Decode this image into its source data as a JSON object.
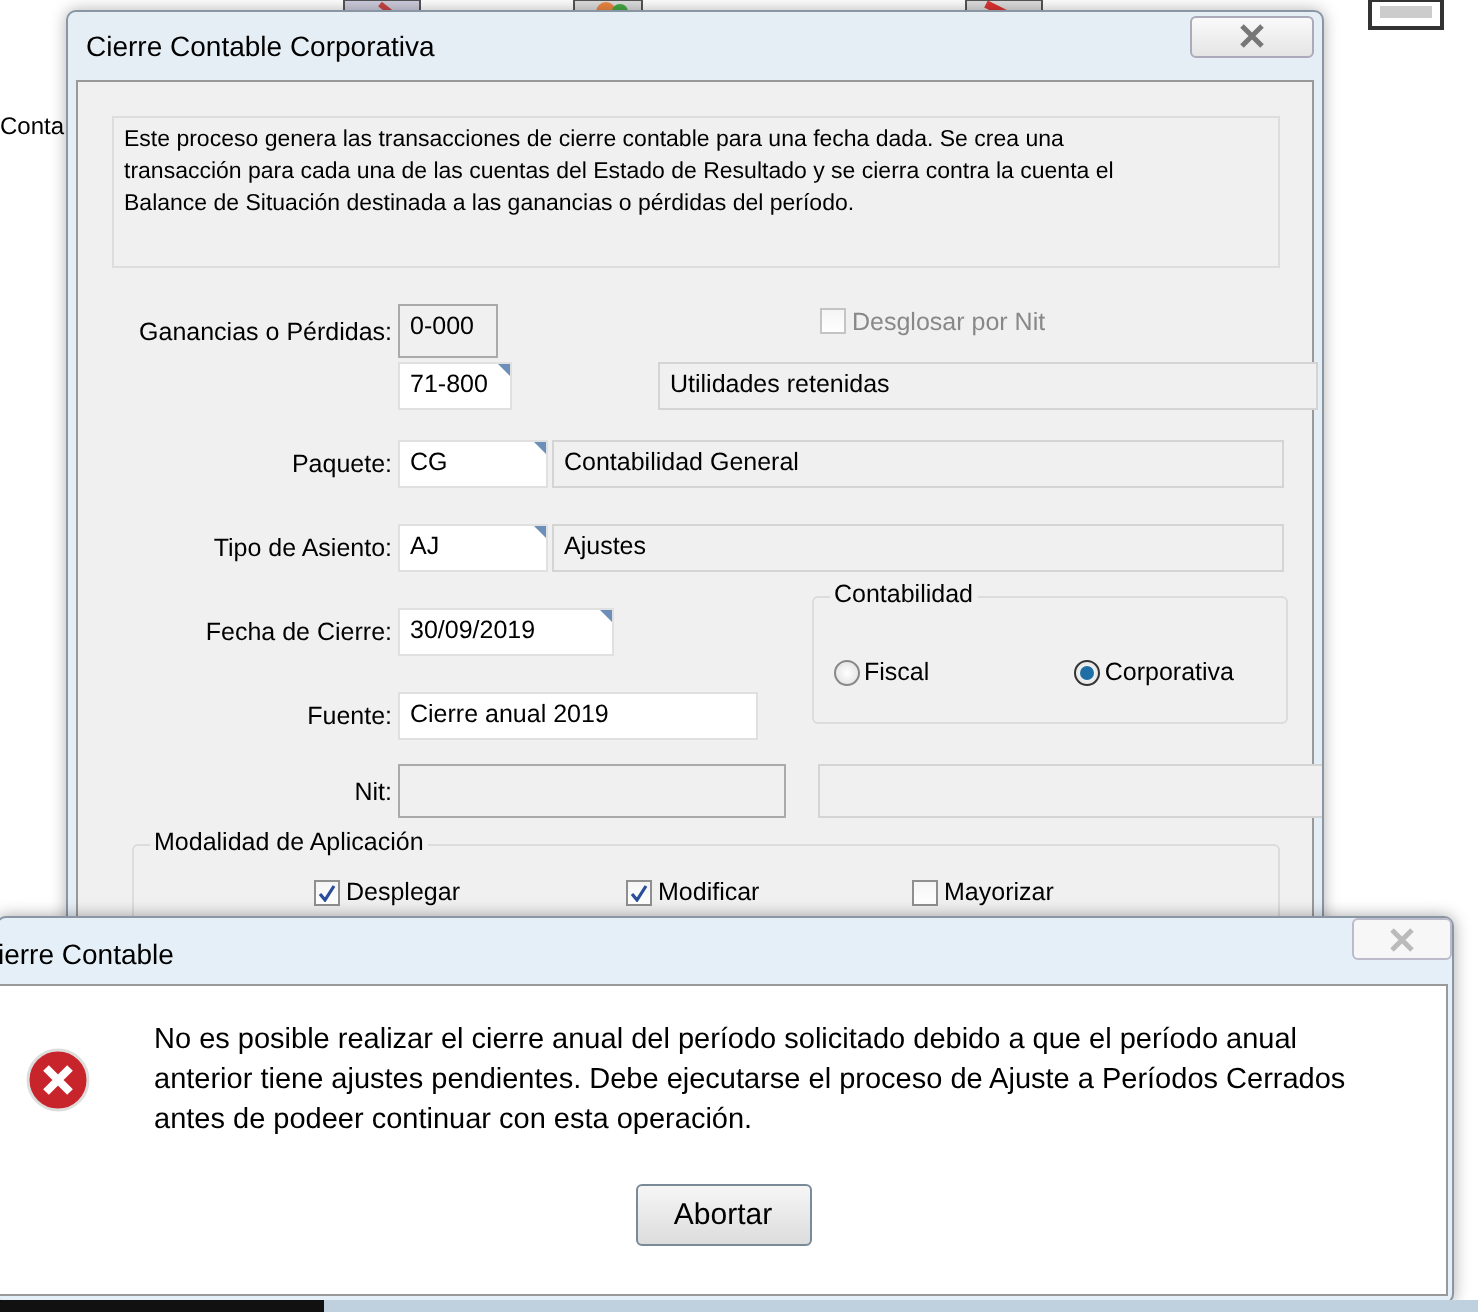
{
  "desktop": {
    "icon_labels": [
      "Conta"
    ]
  },
  "main_window": {
    "title": "Cierre Contable Corporativa",
    "description": "Este proceso genera las transacciones de cierre contable para una fecha dada. Se crea una transacción para cada una de las cuentas del Estado de Resultado y se cierra contra la cuenta el Balance de Situación destinada a las ganancias o pérdidas del período.",
    "ganancias": {
      "label": "Ganancias o Pérdidas:",
      "prefix": "0-000",
      "code": "71-800",
      "name": "Utilidades retenidas"
    },
    "desglosar": {
      "label": "Desglosar por Nit",
      "checked": false,
      "disabled": true
    },
    "paquete": {
      "label": "Paquete:",
      "code": "CG",
      "name": "Contabilidad General"
    },
    "tipo_asiento": {
      "label": "Tipo de Asiento:",
      "code": "AJ",
      "name": "Ajustes"
    },
    "fecha_cierre": {
      "label": "Fecha de Cierre:",
      "value": "30/09/2019"
    },
    "fuente": {
      "label": "Fuente:",
      "value": "Cierre anual 2019"
    },
    "nit": {
      "label": "Nit:"
    },
    "contabilidad": {
      "title": "Contabilidad",
      "options": [
        {
          "label": "Fiscal",
          "selected": false
        },
        {
          "label": "Corporativa",
          "selected": true
        }
      ]
    },
    "modalidad": {
      "title": "Modalidad de Aplicación",
      "options": [
        {
          "label": "Desplegar",
          "checked": true
        },
        {
          "label": "Modificar",
          "checked": true
        },
        {
          "label": "Mayorizar",
          "checked": false
        }
      ]
    }
  },
  "error_dialog": {
    "title": "ierre Contable",
    "message": "No es posible realizar el cierre anual del período solicitado debido a que el período anual anterior tiene ajustes pendientes. Debe ejecutarse el proceso de Ajuste a Períodos Cerrados antes de podeer continuar con esta operación.",
    "button": "Abortar"
  }
}
